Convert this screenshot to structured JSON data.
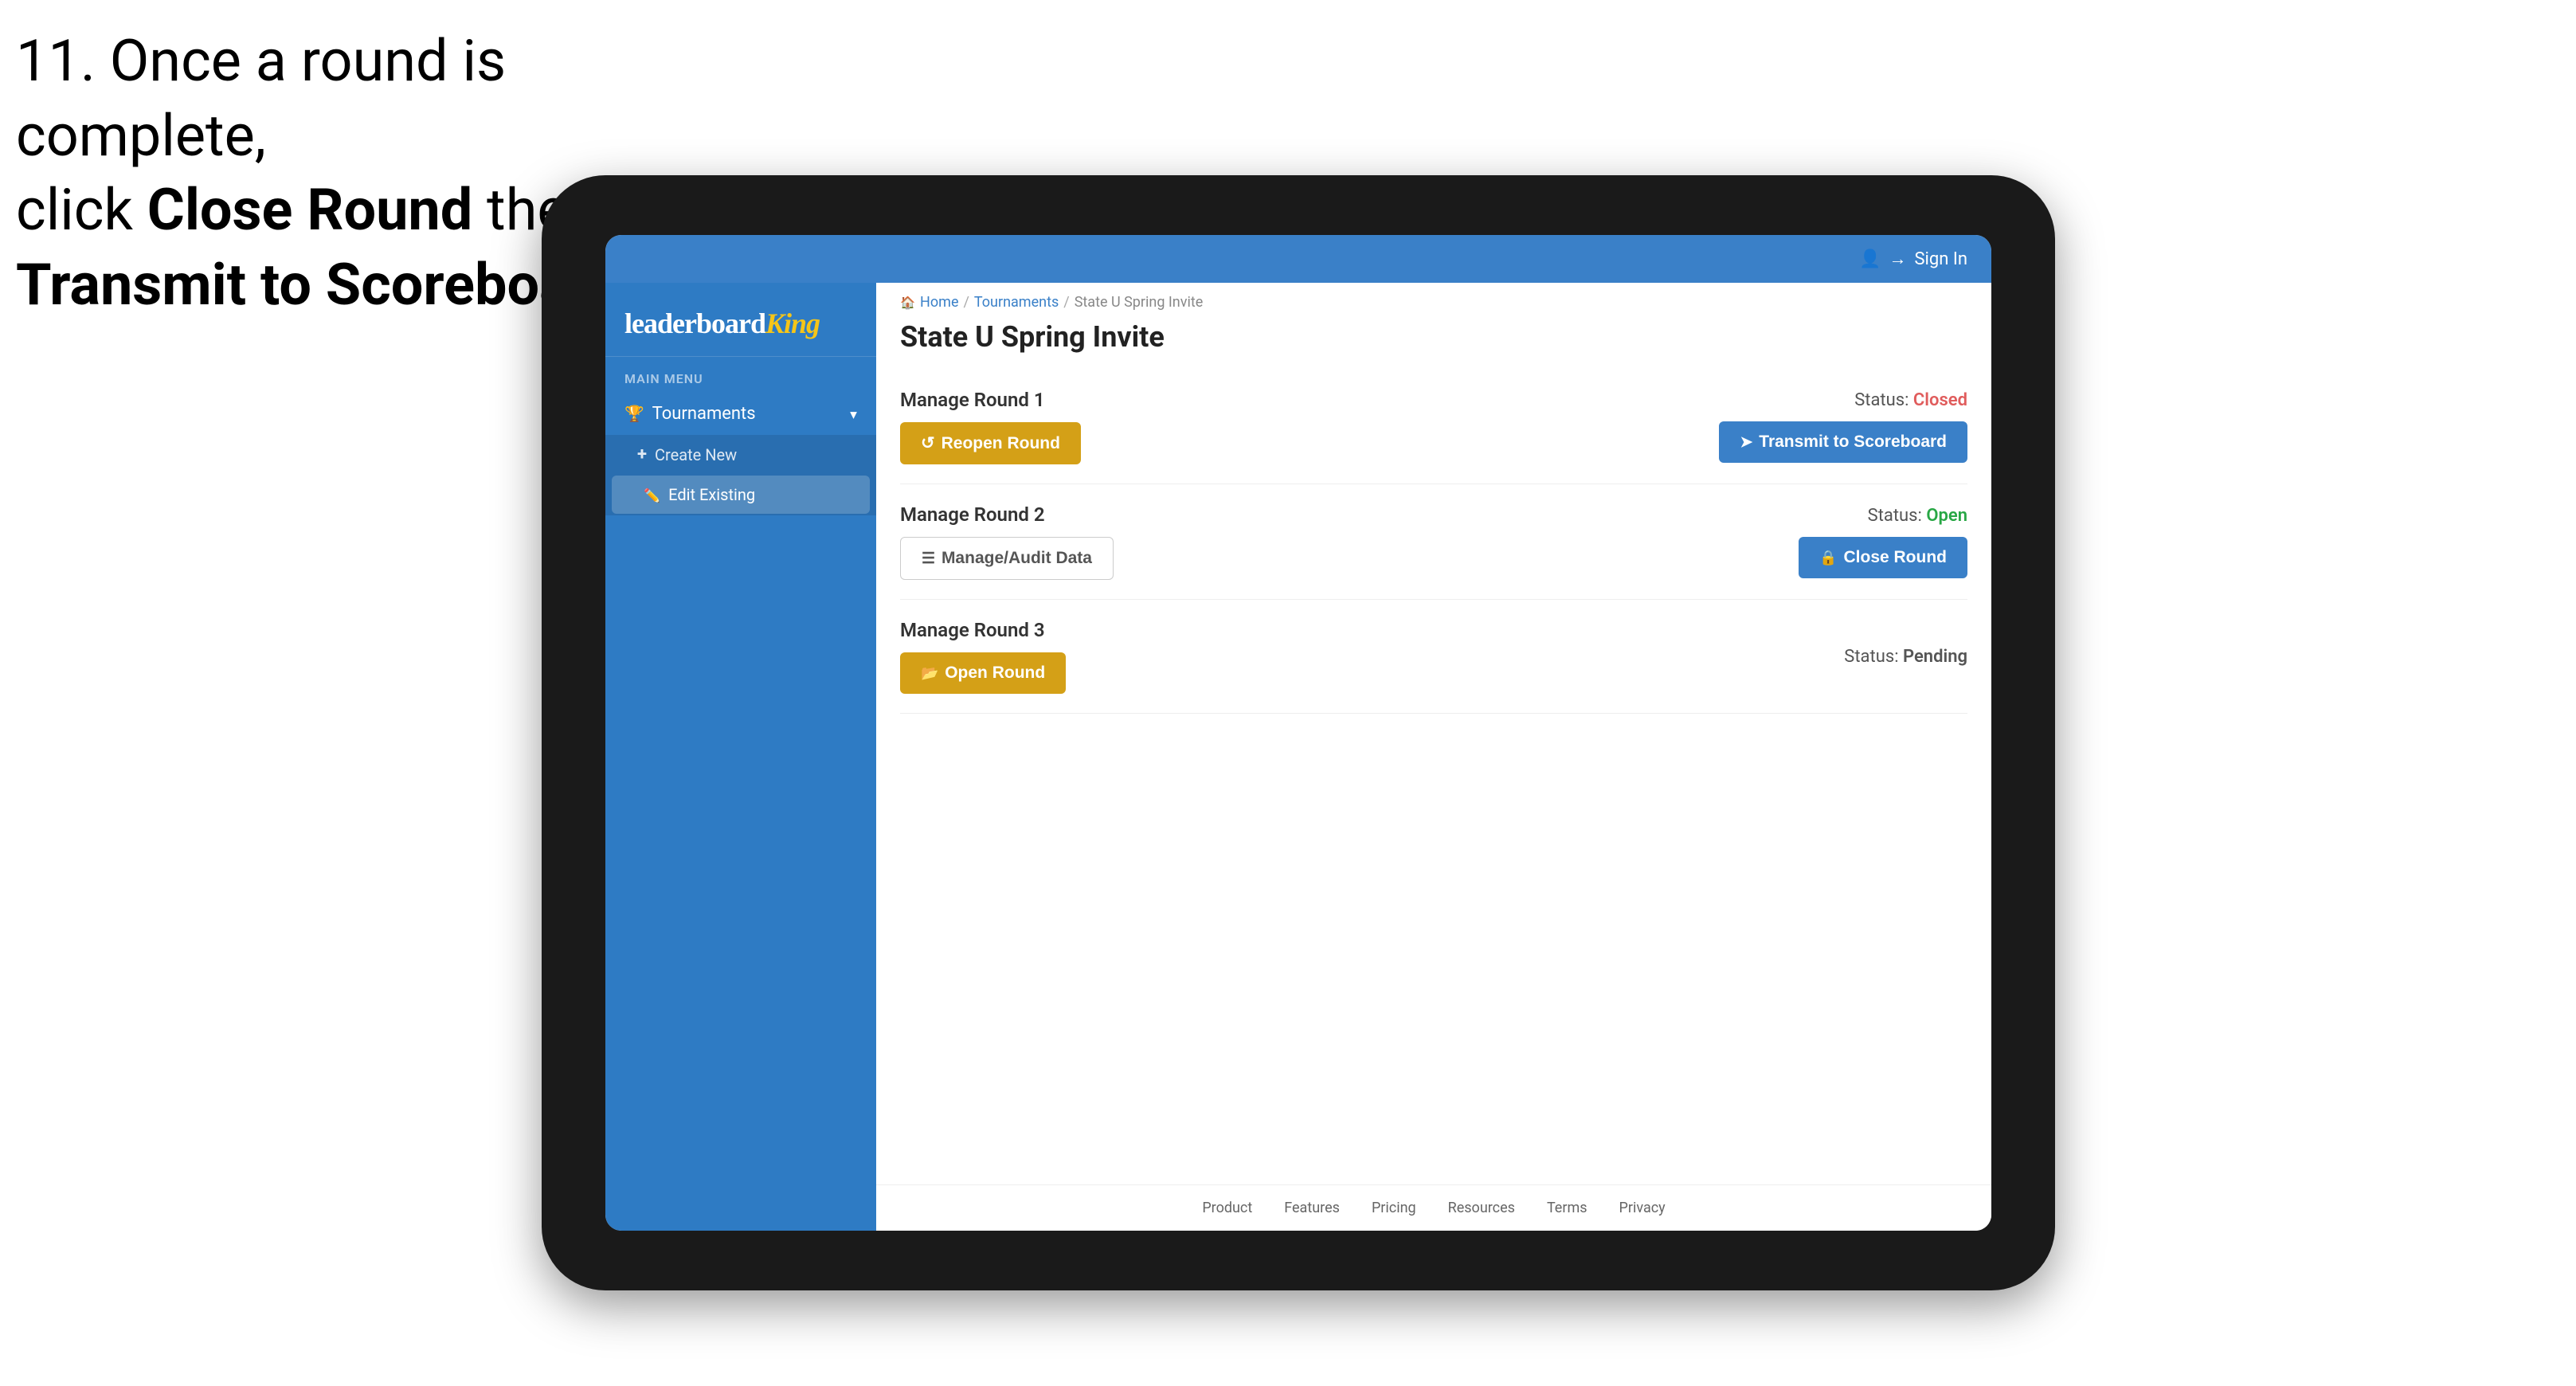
{
  "instruction": {
    "line1": "11. Once a round is complete,",
    "line2_prefix": "click ",
    "line2_bold": "Close Round",
    "line2_suffix": " then click",
    "line3_bold": "Transmit to Scoreboard."
  },
  "topbar": {
    "signin_label": "Sign In"
  },
  "sidebar": {
    "logo_leaderboard": "leaderboard",
    "logo_king": "King",
    "main_menu_label": "MAIN MENU",
    "tournaments_label": "Tournaments",
    "create_new_label": "Create New",
    "edit_existing_label": "Edit Existing"
  },
  "breadcrumb": {
    "home": "Home",
    "tournaments": "Tournaments",
    "current": "State U Spring Invite"
  },
  "page_title": "State U Spring Invite",
  "rounds": [
    {
      "title": "Manage Round 1",
      "status_label": "Status:",
      "status_value": "Closed",
      "status_class": "closed",
      "buttons": [
        {
          "label": "Reopen Round",
          "type": "gold",
          "icon": "reopen"
        }
      ],
      "right_buttons": [
        {
          "label": "Transmit to Scoreboard",
          "type": "blue",
          "icon": "transmit"
        }
      ]
    },
    {
      "title": "Manage Round 2",
      "status_label": "Status:",
      "status_value": "Open",
      "status_class": "open",
      "buttons": [
        {
          "label": "Manage/Audit Data",
          "type": "outline-gray",
          "icon": "manage"
        }
      ],
      "right_buttons": [
        {
          "label": "Close Round",
          "type": "blue",
          "icon": "close"
        }
      ]
    },
    {
      "title": "Manage Round 3",
      "status_label": "Status:",
      "status_value": "Pending",
      "status_class": "pending",
      "buttons": [
        {
          "label": "Open Round",
          "type": "gold",
          "icon": "open"
        }
      ],
      "right_buttons": []
    }
  ],
  "footer": {
    "links": [
      "Product",
      "Features",
      "Pricing",
      "Resources",
      "Terms",
      "Privacy"
    ]
  }
}
